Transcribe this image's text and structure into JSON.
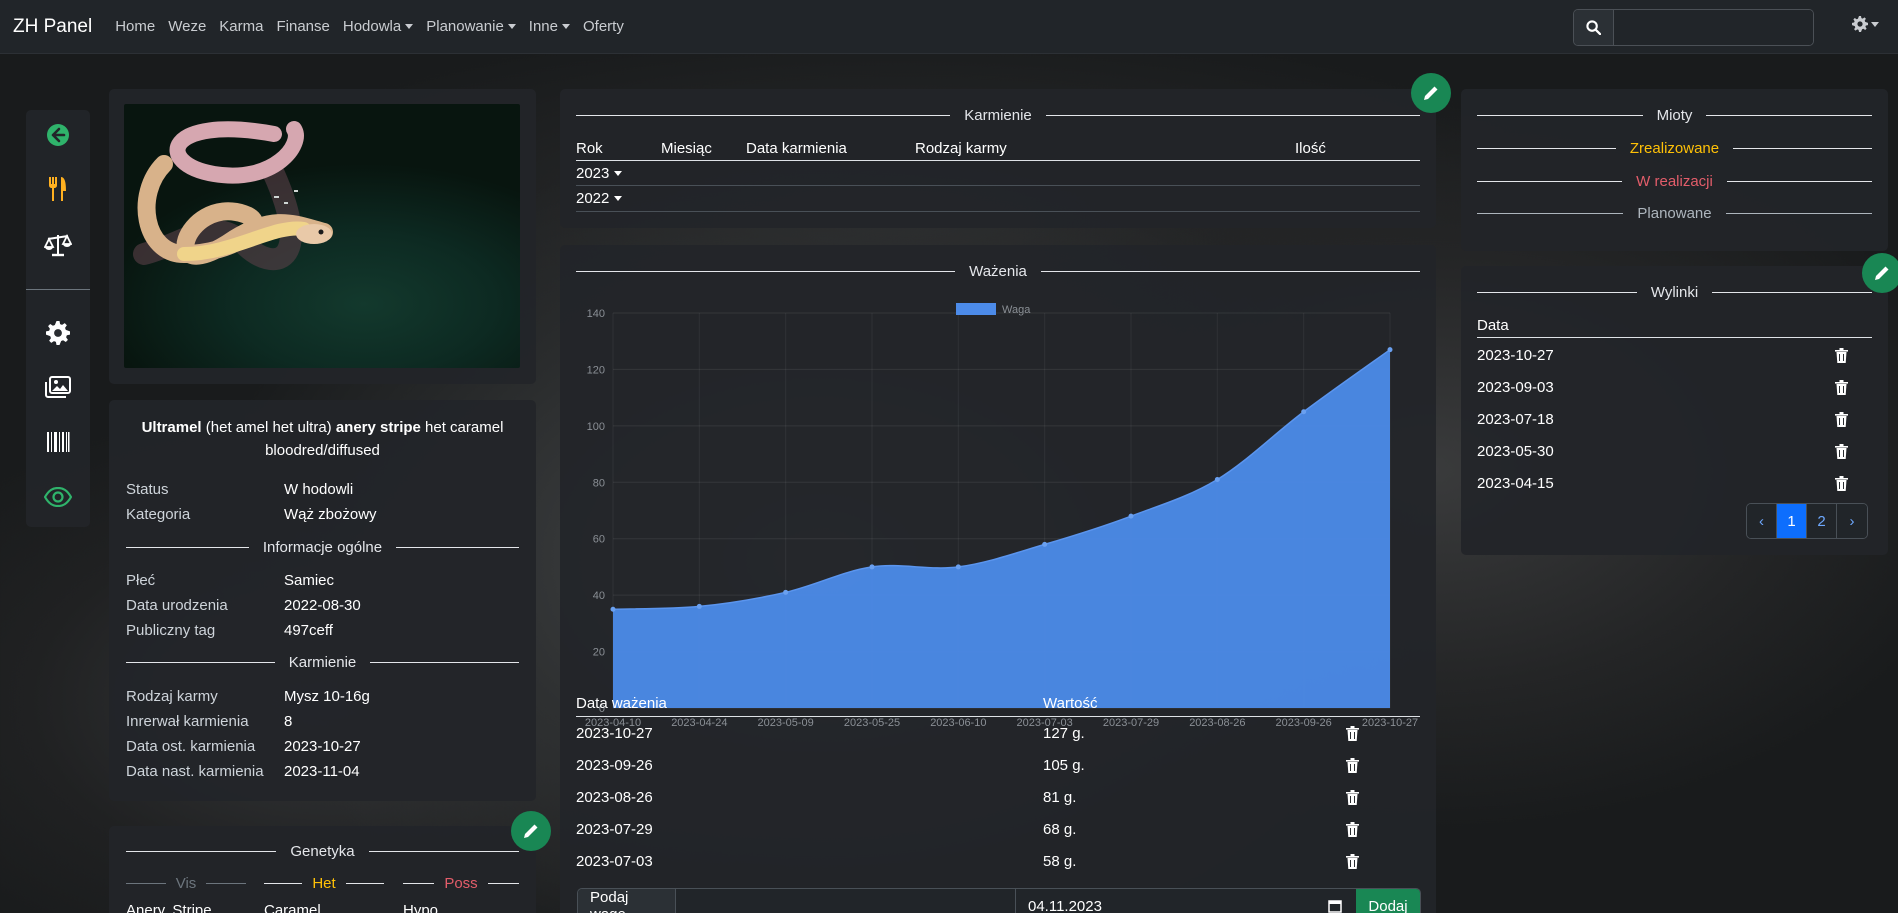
{
  "nav": {
    "brand": "ZH Panel",
    "items": [
      {
        "label": "Home",
        "dropdown": false
      },
      {
        "label": "Weze",
        "dropdown": false
      },
      {
        "label": "Karma",
        "dropdown": false
      },
      {
        "label": "Finanse",
        "dropdown": false
      },
      {
        "label": "Hodowla",
        "dropdown": true
      },
      {
        "label": "Planowanie",
        "dropdown": true
      },
      {
        "label": "Inne",
        "dropdown": true
      },
      {
        "label": "Oferty",
        "dropdown": false
      }
    ],
    "search_placeholder": ""
  },
  "sidebar": {
    "icons": [
      "back-arrow-icon",
      "fork-knife-icon",
      "scale-icon",
      "gear-icon",
      "images-icon",
      "barcode-icon",
      "eye-icon"
    ]
  },
  "animal": {
    "name_parts": [
      {
        "text": "Ultramel",
        "bold": true
      },
      {
        "text": " (het amel het ultra) ",
        "bold": false
      },
      {
        "text": "anery stripe",
        "bold": true
      },
      {
        "text": " het caramel bloodred/diffused",
        "bold": false
      }
    ],
    "status_label": "Status",
    "status_value": "W hodowli",
    "category_label": "Kategoria",
    "category_value": "Wąż zbożowy",
    "general_title": "Informacje ogólne",
    "sex_label": "Płeć",
    "sex_value": "Samiec",
    "birth_label": "Data urodzenia",
    "birth_value": "2022-08-30",
    "tag_label": "Publiczny tag",
    "tag_value": "497ceff",
    "feeding_title": "Karmienie",
    "food_label": "Rodzaj karmy",
    "food_value": "Mysz 10-16g",
    "interval_label": "Inrerwał karmienia",
    "interval_value": "8",
    "last_feed_label": "Data ost. karmienia",
    "last_feed_value": "2023-10-27",
    "next_feed_label": "Data nast. karmienia",
    "next_feed_value": "2023-11-04"
  },
  "genetics": {
    "title": "Genetyka",
    "vis": "Vis",
    "het": "Het",
    "poss": "Poss",
    "vis_items": "Anery, Stripe",
    "het_items": "Caramel",
    "poss_items": "Hypo"
  },
  "feeding_card": {
    "title": "Karmienie",
    "headers": [
      "Rok",
      "Miesiąc",
      "Data karmienia",
      "Rodzaj karmy",
      "Ilość"
    ],
    "years": [
      "2023",
      "2022"
    ]
  },
  "weights_card": {
    "title": "Ważenia",
    "table_headers": [
      "Data ważenia",
      "Wartość"
    ],
    "rows": [
      {
        "date": "2023-10-27",
        "value": "127 g."
      },
      {
        "date": "2023-09-26",
        "value": "105 g."
      },
      {
        "date": "2023-08-26",
        "value": "81 g."
      },
      {
        "date": "2023-07-29",
        "value": "68 g."
      },
      {
        "date": "2023-07-03",
        "value": "58 g."
      }
    ],
    "form_label": "Podaj wagę",
    "form_value": "",
    "form_date": "04.11.2023",
    "form_button": "Dodaj"
  },
  "chart_data": {
    "type": "area",
    "title": "",
    "xlabel": "",
    "ylabel": "",
    "x": [
      "2023-04-10",
      "2023-04-24",
      "2023-05-09",
      "2023-05-25",
      "2023-06-10",
      "2023-07-03",
      "2023-07-29",
      "2023-08-26",
      "2023-09-26",
      "2023-10-27"
    ],
    "series": [
      {
        "name": "Waga",
        "values": [
          35,
          36,
          41,
          50,
          50,
          58,
          68,
          81,
          105,
          127
        ]
      }
    ],
    "ylim": [
      0,
      140
    ],
    "yticks": [
      0,
      20,
      40,
      60,
      80,
      100,
      120,
      140
    ],
    "grid": true,
    "legend": "top-center",
    "color": "#4c8be9"
  },
  "litters": {
    "title": "Mioty",
    "realized": "Zrealizowane",
    "in_progress": "W realizacji",
    "planned": "Planowane"
  },
  "sheds": {
    "title": "Wylinki",
    "header": "Data",
    "rows": [
      "2023-10-27",
      "2023-09-03",
      "2023-07-18",
      "2023-05-30",
      "2023-04-15"
    ],
    "pages": [
      "‹",
      "1",
      "2",
      "›"
    ],
    "active_page": "1"
  },
  "colors": {
    "accent_green": "#198754",
    "het": "#ffc107",
    "poss": "#e35d6a",
    "realized": "#ffc107",
    "in_progress": "#e35d6a",
    "planned": "#adb5bd",
    "page_active": "#0d6efd"
  }
}
